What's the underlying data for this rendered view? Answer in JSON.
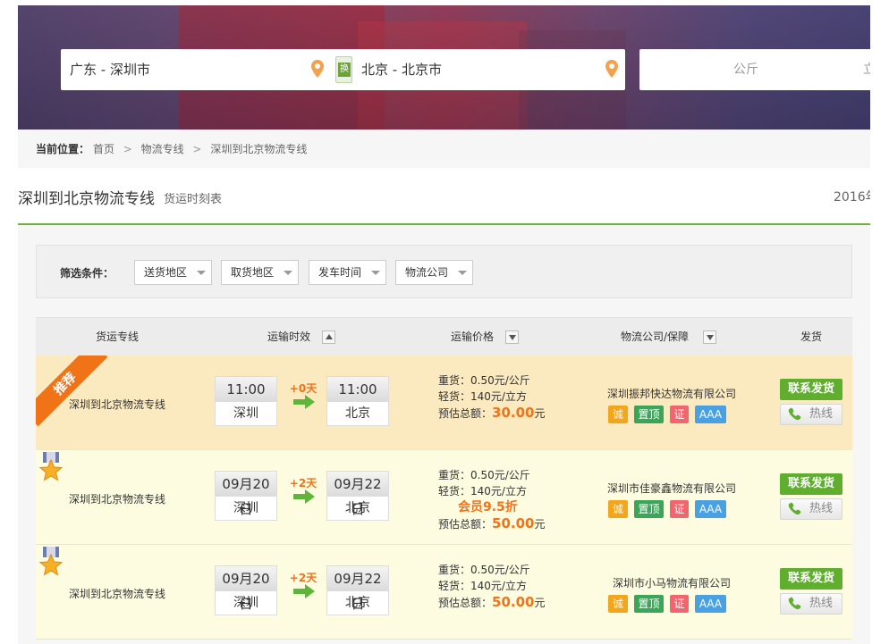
{
  "search": {
    "from": "广东 - 深圳市",
    "to": "北京 - 北京市",
    "swap_label": "换",
    "weight_unit": "公斤",
    "volume_unit_partial": "立"
  },
  "breadcrumb": {
    "label": "当前位置：",
    "items": [
      "首页",
      "物流专线",
      "深圳到北京物流专线"
    ],
    "separator": ">"
  },
  "header": {
    "title": "深圳到北京物流专线",
    "subtitle": "货运时刻表",
    "date_partial": "2016年"
  },
  "filter": {
    "label": "筛选条件：",
    "options": [
      "送货地区",
      "取货地区",
      "发车时间",
      "物流公司"
    ]
  },
  "table": {
    "columns": [
      "货运专线",
      "运输时效",
      "运输价格",
      "物流公司/保障",
      "发货"
    ],
    "badges": [
      "诚",
      "置顶",
      "证",
      "AAA"
    ],
    "contact_label": "联系发货",
    "hotline_label": "热线",
    "recommend_label": "推荐",
    "rows": [
      {
        "route": "深圳到北京物流专线",
        "depart_time": "11:00",
        "depart_city": "深圳",
        "days": "+0天",
        "arrive_time": "11:00",
        "arrive_city": "北京",
        "heavy": "重货：0.50元/公斤",
        "light": "轻货：140元/立方",
        "member": "",
        "total_label": "预估总额：",
        "total_value": "30.00",
        "total_unit": "元",
        "company": "深圳振邦快达物流有限公司",
        "recommended": true
      },
      {
        "route": "深圳到北京物流专线",
        "depart_time": "09月20日",
        "depart_city": "深圳",
        "days": "+2天",
        "arrive_time": "09月22日",
        "arrive_city": "北京",
        "heavy": "重货：0.50元/公斤",
        "light": "轻货：140元/立方",
        "member": "会员9.5折",
        "total_label": "预估总额：",
        "total_value": "50.00",
        "total_unit": "元",
        "company": "深圳市佳豪鑫物流有限公司",
        "recommended": false
      },
      {
        "route": "深圳到北京物流专线",
        "depart_time": "09月20日",
        "depart_city": "深圳",
        "days": "+2天",
        "arrive_time": "09月22日",
        "arrive_city": "北京",
        "heavy": "重货：0.50元/公斤",
        "light": "轻货：140元/立方",
        "member": "",
        "total_label": "预估总额：",
        "total_value": "50.00",
        "total_unit": "元",
        "company": "深圳市小马物流有限公司",
        "recommended": false
      }
    ]
  },
  "colors": {
    "accent_green": "#5fae2e",
    "accent_orange": "#f07318",
    "row_highlight": "#fbe9bf",
    "row_normal": "#fdfbe0"
  },
  "icons": [
    "location-pin-icon",
    "swap-icon",
    "sort-up-icon",
    "sort-down-icon",
    "arrow-right-icon",
    "phone-icon",
    "medal-icon",
    "recommend-ribbon"
  ]
}
